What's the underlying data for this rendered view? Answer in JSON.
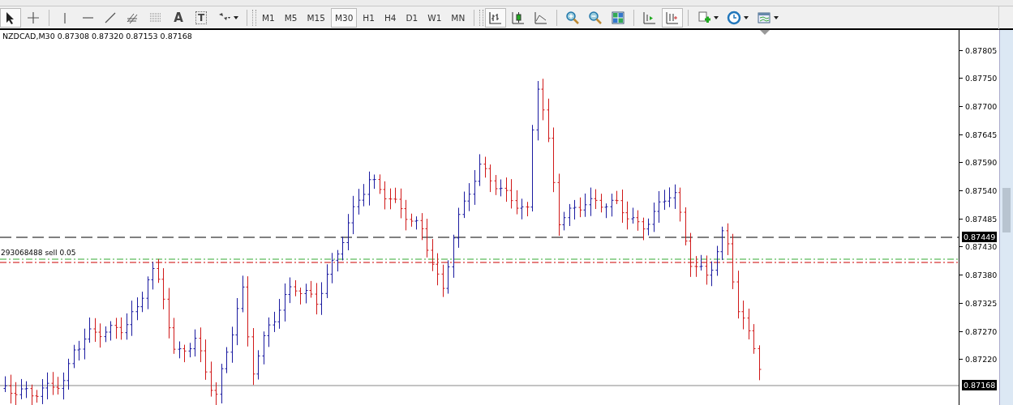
{
  "toolbar": {
    "tools": [
      {
        "kind": "cursor",
        "selected": true
      },
      {
        "kind": "crosshair",
        "selected": false
      },
      {
        "kind": "sep"
      },
      {
        "kind": "vline",
        "selected": false
      },
      {
        "kind": "hline",
        "selected": false
      },
      {
        "kind": "trend",
        "selected": false
      },
      {
        "kind": "channel",
        "selected": false
      },
      {
        "kind": "fibo",
        "selected": false
      },
      {
        "kind": "text",
        "glyph": "A",
        "selected": false
      },
      {
        "kind": "label",
        "glyph": "T",
        "selected": false
      },
      {
        "kind": "shapes",
        "selected": false
      }
    ],
    "timeframes": [
      {
        "label": "M1",
        "selected": false
      },
      {
        "label": "M5",
        "selected": false
      },
      {
        "label": "M15",
        "selected": false
      },
      {
        "label": "M30",
        "selected": true
      },
      {
        "label": "H1",
        "selected": false
      },
      {
        "label": "H4",
        "selected": false
      },
      {
        "label": "D1",
        "selected": false
      },
      {
        "label": "W1",
        "selected": false
      },
      {
        "label": "MN",
        "selected": false
      }
    ],
    "chart_tools": [
      {
        "kind": "bars",
        "selected": true
      },
      {
        "kind": "candles",
        "selected": false
      },
      {
        "kind": "line",
        "selected": false
      },
      {
        "kind": "sep"
      },
      {
        "kind": "zoom-in",
        "selected": false
      },
      {
        "kind": "zoom-out",
        "selected": false
      },
      {
        "kind": "tile",
        "selected": false
      },
      {
        "kind": "sep"
      },
      {
        "kind": "autoscroll",
        "selected": false
      },
      {
        "kind": "shift",
        "selected": true
      },
      {
        "kind": "sep"
      },
      {
        "kind": "indicators",
        "selected": false
      },
      {
        "kind": "periods",
        "selected": false
      },
      {
        "kind": "templates",
        "selected": false
      }
    ]
  },
  "chart": {
    "info": "NZDCAD,M30  0.87308 0.87320 0.87153 0.87168",
    "order_label": "293068488 sell 0.05",
    "price_ticks": [
      "0.87805",
      "0.87750",
      "0.87700",
      "0.87645",
      "0.87590",
      "0.87540",
      "0.87485",
      "0.87430",
      "0.87380",
      "0.87325",
      "0.87270",
      "0.87220"
    ],
    "bid_marker": "0.87449",
    "last_marker": "0.87168"
  }
}
